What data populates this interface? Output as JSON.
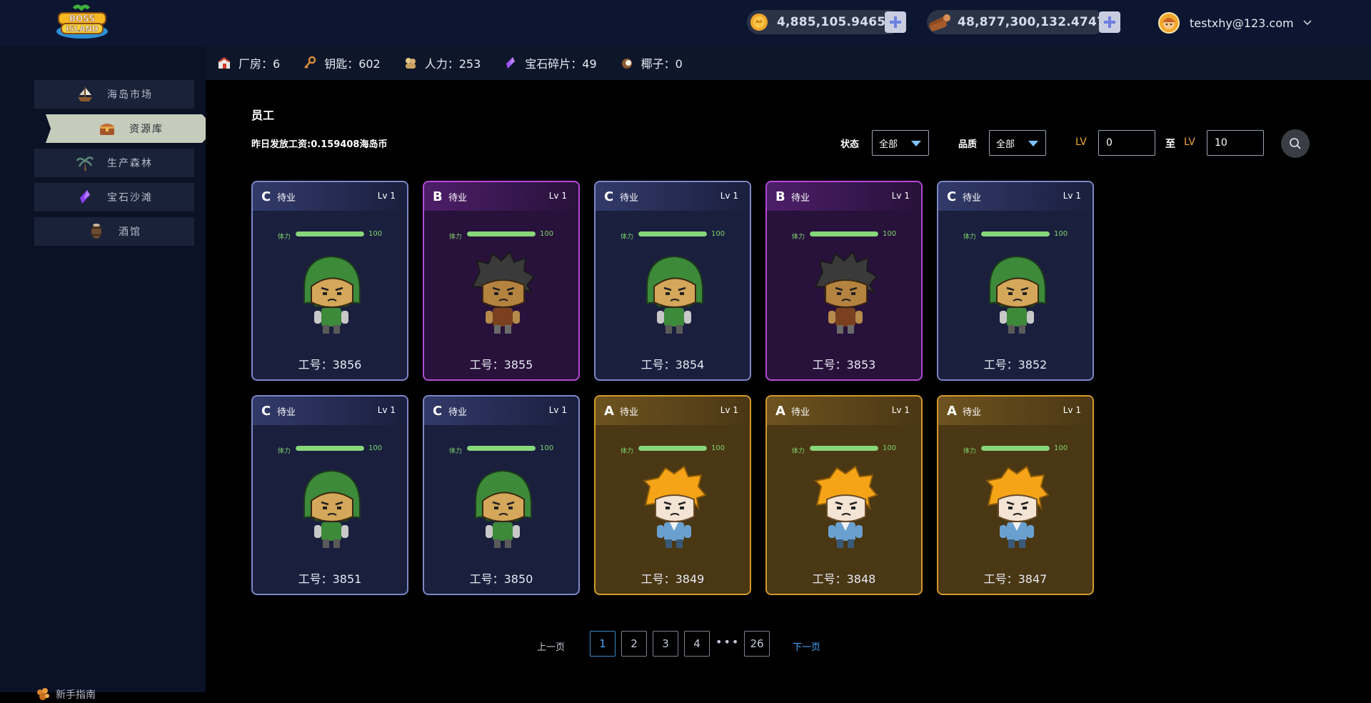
{
  "header": {
    "logo_text": "BOSS ISLAND",
    "coin_balance": "4,885,105.9465",
    "wood_balance": "48,877,300,132.4747",
    "user_email": "testxhy@123.com"
  },
  "sidebar": {
    "items": [
      {
        "label": "海岛市场",
        "icon": "ship-icon"
      },
      {
        "label": "资源库",
        "icon": "treasure-chest-icon",
        "active": true
      },
      {
        "label": "生产森林",
        "icon": "palm-tree-icon"
      },
      {
        "label": "宝石沙滩",
        "icon": "gem-icon"
      },
      {
        "label": "酒馆",
        "icon": "barrel-icon"
      }
    ],
    "guide_label": "新手指南"
  },
  "resources": [
    {
      "label": "厂房：6",
      "icon": "factory-icon"
    },
    {
      "label": "钥匙：602",
      "icon": "key-icon"
    },
    {
      "label": "人力：253",
      "icon": "workers-icon"
    },
    {
      "label": "宝石碎片：49",
      "icon": "gem-shard-icon"
    },
    {
      "label": "椰子：0",
      "icon": "coconut-icon"
    }
  ],
  "main": {
    "title": "员工",
    "wage_text": "昨日发放工资:0.159408海岛币",
    "filters": {
      "status_label": "状态",
      "status_value": "全部",
      "quality_label": "品质",
      "quality_value": "全部",
      "lv_label": "LV",
      "lv_min": "0",
      "to_label": "至",
      "lv_max": "10"
    }
  },
  "cards": [
    {
      "grade": "C",
      "status": "待业",
      "level": "Lv 1",
      "stamina_label": "体力",
      "stamina": 100,
      "stamina_text": "100",
      "work_id": "工号：3856",
      "character": "green-hood"
    },
    {
      "grade": "B",
      "status": "待业",
      "level": "Lv 1",
      "stamina_label": "体力",
      "stamina": 100,
      "stamina_text": "100",
      "work_id": "工号：3855",
      "character": "dark-spiky"
    },
    {
      "grade": "C",
      "status": "待业",
      "level": "Lv 1",
      "stamina_label": "体力",
      "stamina": 100,
      "stamina_text": "100",
      "work_id": "工号：3854",
      "character": "green-hood"
    },
    {
      "grade": "B",
      "status": "待业",
      "level": "Lv 1",
      "stamina_label": "体力",
      "stamina": 100,
      "stamina_text": "100",
      "work_id": "工号：3853",
      "character": "dark-spiky"
    },
    {
      "grade": "C",
      "status": "待业",
      "level": "Lv 1",
      "stamina_label": "体力",
      "stamina": 100,
      "stamina_text": "100",
      "work_id": "工号：3852",
      "character": "green-hood"
    },
    {
      "grade": "C",
      "status": "待业",
      "level": "Lv 1",
      "stamina_label": "体力",
      "stamina": 100,
      "stamina_text": "100",
      "work_id": "工号：3851",
      "character": "green-hood"
    },
    {
      "grade": "C",
      "status": "待业",
      "level": "Lv 1",
      "stamina_label": "体力",
      "stamina": 100,
      "stamina_text": "100",
      "work_id": "工号：3850",
      "character": "green-hood"
    },
    {
      "grade": "A",
      "status": "待业",
      "level": "Lv 1",
      "stamina_label": "体力",
      "stamina": 100,
      "stamina_text": "100",
      "work_id": "工号：3849",
      "character": "blond"
    },
    {
      "grade": "A",
      "status": "待业",
      "level": "Lv 1",
      "stamina_label": "体力",
      "stamina": 100,
      "stamina_text": "100",
      "work_id": "工号：3848",
      "character": "blond"
    },
    {
      "grade": "A",
      "status": "待业",
      "level": "Lv 1",
      "stamina_label": "体力",
      "stamina": 100,
      "stamina_text": "100",
      "work_id": "工号：3847",
      "character": "blond"
    }
  ],
  "pagination": {
    "prev_label": "上一页",
    "next_label": "下一页",
    "pages": [
      "1",
      "2",
      "3",
      "4"
    ],
    "ellipsis": "•••",
    "last_page": "26",
    "current": "1"
  },
  "colors": {
    "grade_C": "#7d87c8",
    "grade_B": "#b44ad4",
    "grade_A": "#d3982a",
    "stamina": "#86d67a",
    "accent_blue": "#4aa7ff",
    "lv_orange": "#f0a63a"
  }
}
